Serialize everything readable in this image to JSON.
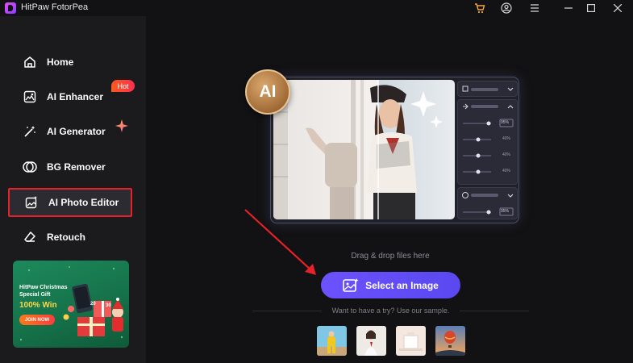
{
  "app": {
    "title": "HitPaw FotorPea"
  },
  "titlebar_icons": [
    "cart-icon",
    "account-icon",
    "menu-icon",
    "minimize-icon",
    "maximize-icon",
    "close-icon"
  ],
  "sidebar": {
    "items": [
      {
        "label": "Home",
        "icon": "home-icon"
      },
      {
        "label": "AI Enhancer",
        "icon": "enhancer-icon"
      },
      {
        "label": "AI Generator",
        "icon": "magic-wand-icon"
      },
      {
        "label": "BG Remover",
        "icon": "bg-remover-icon"
      },
      {
        "label": "AI Photo Editor",
        "icon": "photo-editor-icon",
        "selected": true
      },
      {
        "label": "Retouch",
        "icon": "eraser-icon"
      }
    ],
    "hot_badge": "Hot",
    "promo": {
      "line1": "HitPaw Christmas Special Gift",
      "line2": "100% Win",
      "button": "JOIN NOW",
      "badge": "20",
      "badge2": "30"
    }
  },
  "main": {
    "ai_badge": "AI",
    "panel_values": [
      "95%",
      "40%",
      "40%",
      "40%",
      "95%"
    ],
    "drag_text": "Drag & drop files here",
    "select_button": "Select an Image",
    "try_text": "Want to have a try? Use our sample.",
    "samples": [
      "sample-yellow-person",
      "sample-portrait-woman",
      "sample-product",
      "sample-hot-air-balloon"
    ]
  },
  "colors": {
    "accent": "#6b52ff",
    "highlight": "#e5212a",
    "hot": "#ff4b2b"
  }
}
